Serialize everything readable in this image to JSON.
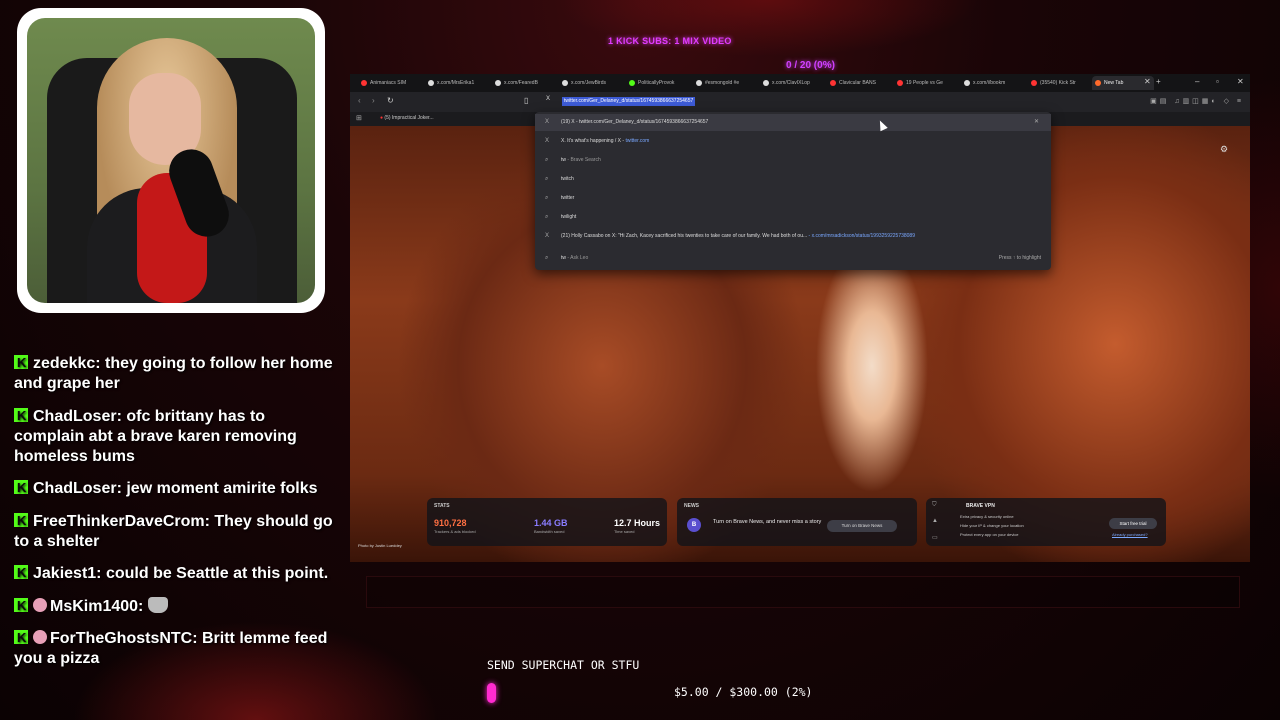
{
  "overlay": {
    "banner": "1 KICK SUBS: 1 MIX VIDEO",
    "counter": "0 / 20 (0%)"
  },
  "chat": [
    {
      "user": "zedekkc",
      "text": "they going to follow her home and grape her"
    },
    {
      "user": "ChadLoser",
      "text": "ofc brittany has to complain abt a brave karen removing homeless bums"
    },
    {
      "user": "ChadLoser",
      "text": "jew moment amirite folks"
    },
    {
      "user": "FreeThinkerDaveCrom",
      "text": "They should go to a shelter"
    },
    {
      "user": "Jakiest1",
      "text": "could be Seattle at this point."
    },
    {
      "user": "MsKim1400",
      "text": ""
    },
    {
      "user": "ForTheGhostsNTC",
      "text": "Britt lemme feed you a pizza"
    }
  ],
  "browser": {
    "tabs": [
      {
        "label": "Animaniacs SIM",
        "color": "#ff3333"
      },
      {
        "label": "x.com/MrsErika1",
        "color": "#dddddd"
      },
      {
        "label": "x.com/FearedB",
        "color": "#dddddd"
      },
      {
        "label": "x.com/JewBirds",
        "color": "#dddddd"
      },
      {
        "label": "PoliticallyProvok",
        "color": "#53fc18"
      },
      {
        "label": "#esmongold #e",
        "color": "#dddddd"
      },
      {
        "label": "x.com/ClavIXLop",
        "color": "#dddddd"
      },
      {
        "label": "Clavicular BANS",
        "color": "#ff3333"
      },
      {
        "label": "19 People vs Ge",
        "color": "#ff3333"
      },
      {
        "label": "x.com/i/bookm",
        "color": "#dddddd"
      },
      {
        "label": "(35540) Kick Str",
        "color": "#ff3333"
      },
      {
        "label": "New Tab",
        "color": "#ff6a2b"
      }
    ],
    "url": "twitter.com/Ger_Delaney_d/status/1674593866637254657",
    "bookmark": "(5) Impractical Joker...",
    "dropdown": [
      {
        "icon": "X",
        "text": "(19) X - twitter.com/Ger_Delaney_d/status/1674593866637254657",
        "muted": "",
        "extra": "",
        "right": "×"
      },
      {
        "icon": "X",
        "text": "X. It's what's happening / X - ",
        "muted": "",
        "extra": "twitter.com",
        "right": ""
      },
      {
        "icon": "⌕",
        "text": "tw",
        "muted": " - Brave Search",
        "extra": "",
        "right": ""
      },
      {
        "icon": "⌕",
        "text": "twitch",
        "muted": "",
        "extra": "",
        "right": ""
      },
      {
        "icon": "⌕",
        "text": "twitter",
        "muted": "",
        "extra": "",
        "right": ""
      },
      {
        "icon": "⌕",
        "text": "twilight",
        "muted": "",
        "extra": "",
        "right": ""
      },
      {
        "icon": "X",
        "text": "(21) Holly Cassabo on X: \"Hi Zach, Kacey sacrificed his twenties to take care of our family. We had both of ou...",
        "muted": "",
        "extra": " - x.com/mrsadickson/status/1993259225738089",
        "right": ""
      },
      {
        "icon": "⌕",
        "text": "tw",
        "muted": " - Ask Leo",
        "extra": "",
        "right": "Press ↑ to highlight"
      }
    ],
    "photo_credit": "Photo by Justin Lueddey",
    "stats": {
      "title": "STATS",
      "items": [
        {
          "value": "910,728",
          "label": "Trackers & ads blocked",
          "color": "#ff7043"
        },
        {
          "value": "1.44 GB",
          "label": "Bandwidth saved",
          "color": "#8a7cff"
        },
        {
          "value": "12.7 Hours",
          "label": "Time saved",
          "color": "#ffffff"
        }
      ]
    },
    "news": {
      "title": "NEWS",
      "text": "Turn on Brave News, and never miss a story",
      "button": "Turn on Brave News"
    },
    "vpn": {
      "title": "BRAVE VPN",
      "features": [
        "Extra privacy & security online",
        "Hide your IP & change your location",
        "Protect every app on your device"
      ],
      "button": "Start free trial",
      "link": "Already purchased?"
    }
  },
  "superchat": {
    "label": "SEND SUPERCHAT OR STFU",
    "amount": "$5.00 / $300.00 (2%)",
    "progress_fraction": 0.0167
  }
}
